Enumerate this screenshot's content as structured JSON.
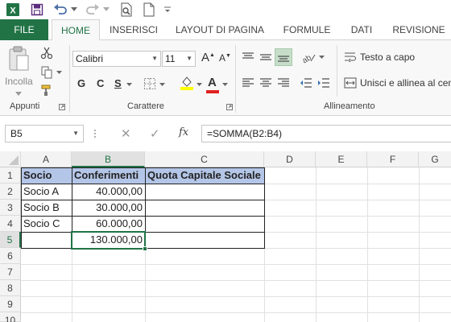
{
  "colors": {
    "accent": "#217346",
    "header_fill": "#b4c6e7"
  },
  "quick_access": {
    "icons": [
      "excel-logo-icon",
      "save-icon",
      "undo-icon",
      "redo-icon",
      "print-preview-icon",
      "new-document-icon",
      "customize-dropdown-icon"
    ]
  },
  "tabs": [
    "FILE",
    "HOME",
    "INSERISCI",
    "LAYOUT DI PAGINA",
    "FORMULE",
    "DATI",
    "REVISIONE"
  ],
  "ribbon": {
    "clipboard": {
      "paste_label": "Incolla",
      "group_label": "Appunti"
    },
    "font": {
      "font_name": "Calibri",
      "font_size": "11",
      "bold": "G",
      "italic": "C",
      "underline": "S",
      "grow": "A",
      "shrink": "A",
      "font_color": "A",
      "group_label": "Carattere"
    },
    "alignment": {
      "wrap_text": "Testo a capo",
      "merge_center": "Unisci e allinea al centro",
      "group_label": "Allineamento"
    }
  },
  "formula_bar": {
    "name_box": "B5",
    "cancel": "✕",
    "enter": "✓",
    "fx": "fx",
    "formula": "=SOMMA(B2:B4)"
  },
  "sheet": {
    "columns": [
      "A",
      "B",
      "C",
      "D",
      "E",
      "F",
      "G"
    ],
    "rows": [
      "1",
      "2",
      "3",
      "4",
      "5",
      "6",
      "7",
      "8",
      "9",
      "10"
    ],
    "selected_cell": "B5",
    "headers": [
      "Socio",
      "Conferimenti",
      "Quota Capitale Sociale"
    ],
    "data_rows": [
      {
        "socio": "Socio A",
        "conferimenti": "40.000,00",
        "quota": ""
      },
      {
        "socio": "Socio B",
        "conferimenti": "30.000,00",
        "quota": ""
      },
      {
        "socio": "Socio C",
        "conferimenti": "60.000,00",
        "quota": ""
      }
    ],
    "total_row": {
      "socio": "",
      "conferimenti": "130.000,00",
      "quota": ""
    }
  }
}
